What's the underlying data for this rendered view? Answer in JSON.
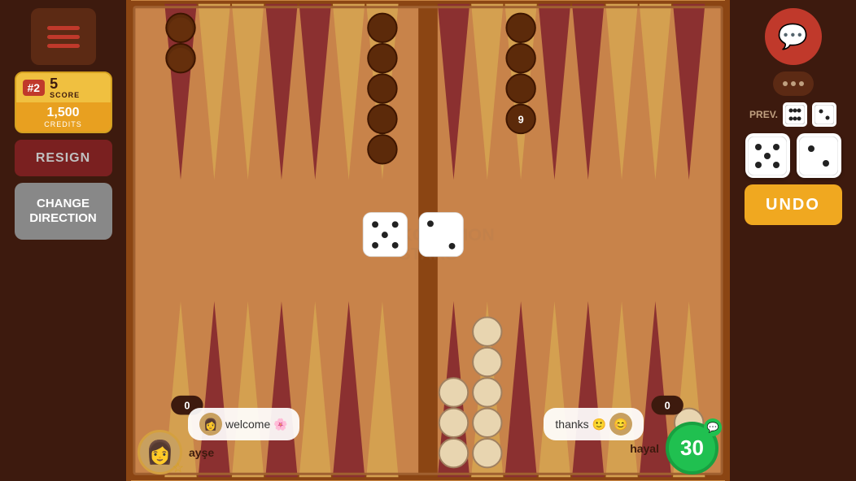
{
  "left_panel": {
    "menu_label": "Menu",
    "rank": "#2",
    "score": "5",
    "score_label": "SCORE",
    "credits": "1,500",
    "credits_label": "CREDITS",
    "resign_label": "RESIGN",
    "change_direction_label": "CHANGE DIRECTION"
  },
  "right_panel": {
    "prev_label": "PREV.",
    "undo_label": "UNDO",
    "prev_die1": "⚅",
    "prev_die2": "⚁",
    "current_die1_value": 5,
    "current_die2_value": 2
  },
  "board": {
    "watermark": "BACKGAMMON STARS",
    "die_left_value": 5,
    "die_right_value": 2,
    "stacked_checker_number": "9"
  },
  "player_left": {
    "name": "ayşe",
    "score": "0",
    "chat_message": "welcome 🌸",
    "avatar_emoji": "👩"
  },
  "player_right": {
    "name": "hayal",
    "score": "0",
    "timer": "30",
    "chat_message": "thanks 🙂",
    "avatar_emoji": "👤"
  }
}
